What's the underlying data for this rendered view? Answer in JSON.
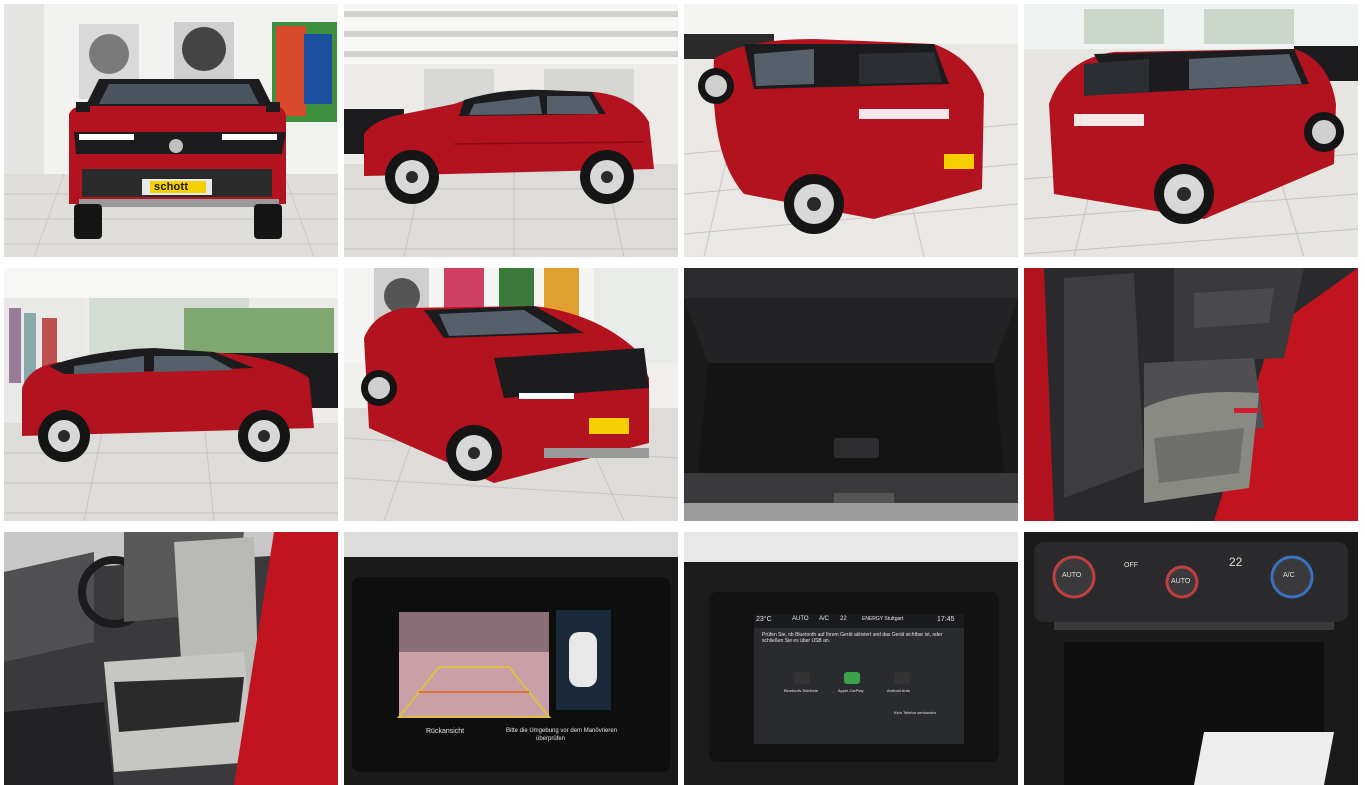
{
  "gallery": {
    "photos": [
      {
        "subject": "front view"
      },
      {
        "subject": "side view"
      },
      {
        "subject": "rear three-quarter view"
      },
      {
        "subject": "rear three-quarter view right"
      },
      {
        "subject": "side view left"
      },
      {
        "subject": "front three-quarter view"
      },
      {
        "subject": "trunk"
      },
      {
        "subject": "rear seats"
      },
      {
        "subject": "front seats"
      },
      {
        "subject": "rear camera display"
      },
      {
        "subject": "infotainment display"
      },
      {
        "subject": "climate controls"
      }
    ],
    "dealer_plate": "schott",
    "camera_screen": {
      "label": "Rückansicht",
      "hint_line1": "Bitte die Umgebung vor dem Manövrieren",
      "hint_line2": "überprüfen"
    },
    "infotainment_screen": {
      "temp": "23°C",
      "auto": "AUTO",
      "ac": "A/C",
      "fan": "22",
      "station": "ENERGY Stuttgart",
      "time": "17:45",
      "message": "Prüfen Sie, ob Bluetooth auf Ihrem Gerät aktiviert und das Gerät sichtbar ist, oder schließen Sie es über USB an.",
      "apps": [
        "Bluetooth-Telefonie",
        "Apple CarPlay",
        "Android Auto"
      ],
      "footer": "Kein Telefon verbunden"
    },
    "climate": {
      "temp_right": "22",
      "left_dial": "AUTO",
      "mid_dial": "AUTO",
      "right_dial": "A/C",
      "off_label": "OFF"
    },
    "colors": {
      "car_red": "#b3121f",
      "roof_black": "#1c1c1e",
      "floor": "#dcdcd8",
      "wall": "#f1f1ef"
    }
  }
}
